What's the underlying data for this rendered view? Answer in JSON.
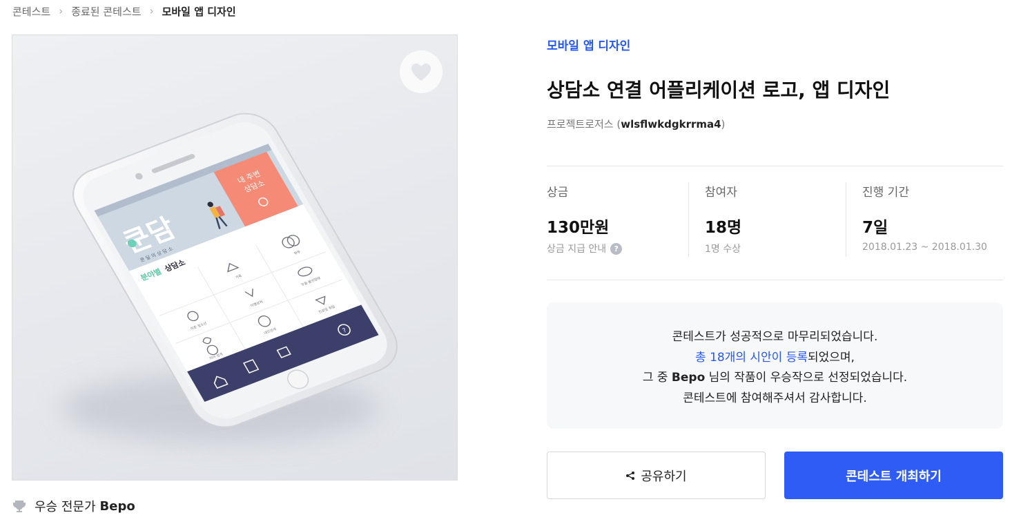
{
  "breadcrumb": {
    "items": [
      "콘테스트",
      "종료된 콘테스트",
      "모바일 앱 디자인"
    ]
  },
  "hero": {
    "favorite_icon": "heart-icon",
    "screen": {
      "banner_text": "내 주변 상담소",
      "logo_text": "쿤담",
      "logo_sub": "쿤 달 의 상 담 소",
      "section_title_colored": "분야별",
      "section_title_dark": "상담소",
      "item_labels": [
        "부부",
        "가족",
        "미혼 청소년",
        "이별상처",
        "우울·불안장애",
        "연인",
        "대인관계",
        "진로및 취업",
        "자아·성격"
      ]
    }
  },
  "winner": {
    "label": "우승 전문가",
    "name": "Bepo",
    "icon": "trophy-icon"
  },
  "contest": {
    "category": "모바일 앱 디자인",
    "title": "상담소 연결 어플리케이션 로고, 앱 디자인",
    "owner_company": "프로젝트로저스 (",
    "owner_id": "wlsflwkdgkrrma4",
    "owner_close": ")"
  },
  "stats": {
    "prize": {
      "label": "상금",
      "value": "130만원",
      "sub": "상금 지급 안내",
      "help_icon": "question-icon"
    },
    "participants": {
      "label": "참여자",
      "value": "18명",
      "sub": "1명 수상"
    },
    "period": {
      "label": "진행 기간",
      "value": "7일",
      "sub": "2018.01.23 ~ 2018.01.30"
    }
  },
  "notice": {
    "line1": "콘테스트가 성공적으로 마무리되었습니다.",
    "line2_link": "총 18개의 시안이 등록",
    "line2_rest": "되었으며,",
    "line3_pre": "그 중 ",
    "line3_name": "Bepo",
    "line3_rest": " 님의 작품이 우승작으로 선정되었습니다.",
    "line4": "콘테스트에 참여해주셔서 감사합니다."
  },
  "actions": {
    "share_label": "공유하기",
    "share_icon": "share-icon",
    "host_label": "콘테스트 개최하기"
  },
  "colors": {
    "accent": "#2f5cf5",
    "link": "#2557f4",
    "coral": "#f58a76",
    "navy": "#3d3f6b"
  }
}
